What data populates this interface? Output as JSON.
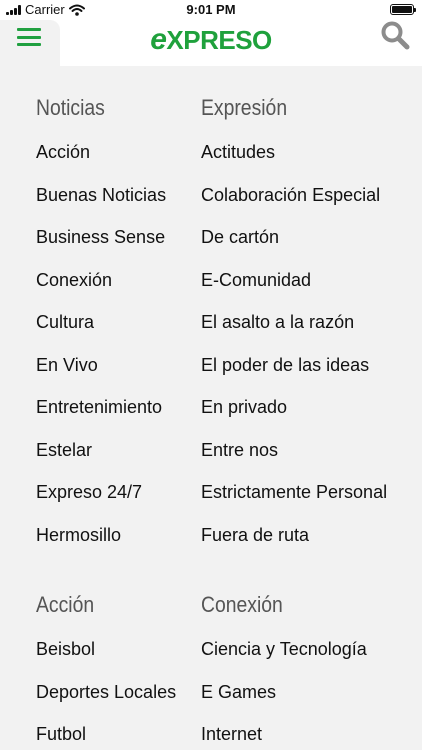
{
  "status_bar": {
    "carrier": "Carrier",
    "time": "9:01 PM"
  },
  "header": {
    "logo_initial": "e",
    "logo_rest": "XPRESO",
    "brand_color": "#1fa13c"
  },
  "icons": {
    "menu": "hamburger-icon",
    "search": "search-icon",
    "wifi": "wifi-icon",
    "battery": "battery-icon"
  },
  "sections": [
    {
      "left": {
        "heading": "Noticias",
        "items": [
          "Acción",
          "Buenas Noticias",
          "Business Sense",
          "Conexión",
          "Cultura",
          "En Vivo",
          "Entretenimiento",
          "Estelar",
          "Expreso 24/7",
          "Hermosillo"
        ]
      },
      "right": {
        "heading": "Expresión",
        "items": [
          "Actitudes",
          "Colaboración Especial",
          "De cartón",
          "E-Comunidad",
          "El asalto a la razón",
          "El poder de las ideas",
          "En privado",
          "Entre nos",
          "Estrictamente Personal",
          "Fuera de ruta"
        ]
      }
    },
    {
      "left": {
        "heading": "Acción",
        "items": [
          "Beisbol",
          "Deportes Locales",
          "Futbol"
        ]
      },
      "right": {
        "heading": "Conexión",
        "items": [
          "Ciencia y Tecnología",
          "E Games",
          "Internet"
        ]
      }
    }
  ]
}
